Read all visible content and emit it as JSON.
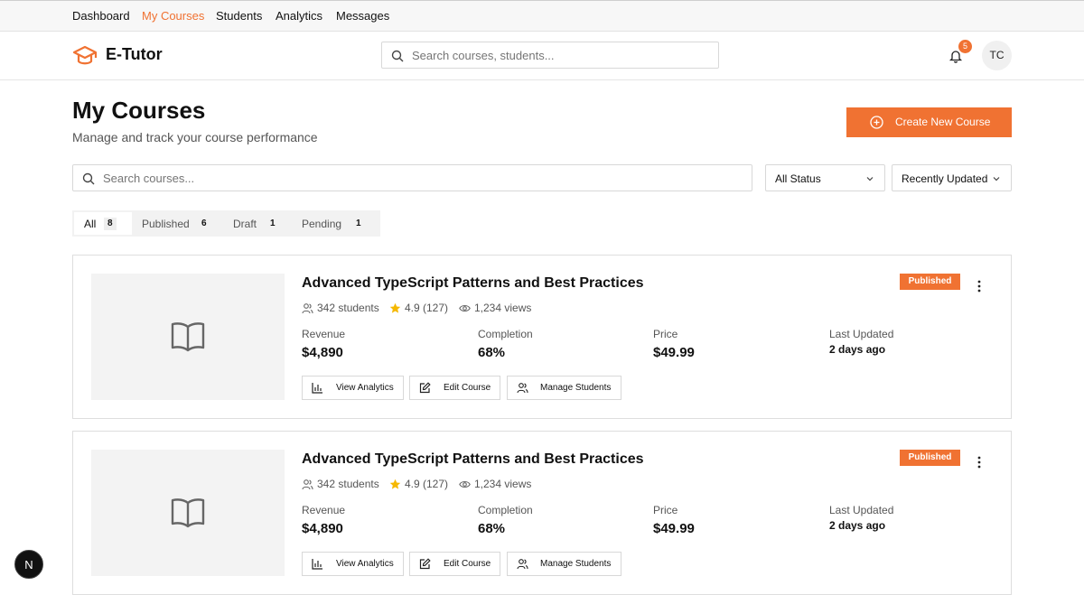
{
  "topnav": {
    "items": [
      {
        "label": "Dashboard",
        "active": false
      },
      {
        "label": "My Courses",
        "active": true
      },
      {
        "label": "Students",
        "active": false
      },
      {
        "label": "Analytics",
        "active": false
      },
      {
        "label": "Messages",
        "active": false
      }
    ]
  },
  "header": {
    "brand": "E-Tutor",
    "logo_icon": "graduation-cap-icon",
    "search_placeholder": "Search courses, students...",
    "notification_count": "5",
    "avatar_initials": "TC"
  },
  "page": {
    "title": "My Courses",
    "subtitle": "Manage and track your course performance",
    "create_button": "Create New Course"
  },
  "filters": {
    "search_placeholder": "Search courses...",
    "status_select": "All Status",
    "sort_select": "Recently Updated"
  },
  "tabs": [
    {
      "label": "All",
      "count": "8",
      "active": true
    },
    {
      "label": "Published",
      "count": "6",
      "active": false
    },
    {
      "label": "Draft",
      "count": "1",
      "active": false
    },
    {
      "label": "Pending",
      "count": "1",
      "active": false
    }
  ],
  "courses": [
    {
      "title": "Advanced TypeScript Patterns and Best Practices",
      "status": "Published",
      "students": "342 students",
      "rating": "4.9 (127)",
      "views": "1,234 views",
      "revenue_label": "Revenue",
      "revenue": "$4,890",
      "completion_label": "Completion",
      "completion": "68%",
      "price_label": "Price",
      "price": "$49.99",
      "updated_label": "Last Updated",
      "updated": "2 days ago",
      "actions": [
        "View Analytics",
        "Edit Course",
        "Manage Students"
      ]
    },
    {
      "title": "Advanced TypeScript Patterns and Best Practices",
      "status": "Published",
      "students": "342 students",
      "rating": "4.9 (127)",
      "views": "1,234 views",
      "revenue_label": "Revenue",
      "revenue": "$4,890",
      "completion_label": "Completion",
      "completion": "68%",
      "price_label": "Price",
      "price": "$49.99",
      "updated_label": "Last Updated",
      "updated": "2 days ago",
      "actions": [
        "View Analytics",
        "Edit Course",
        "Manage Students"
      ]
    }
  ],
  "dev_badge": "N",
  "colors": {
    "accent": "#f07232",
    "star": "#f5b800"
  }
}
